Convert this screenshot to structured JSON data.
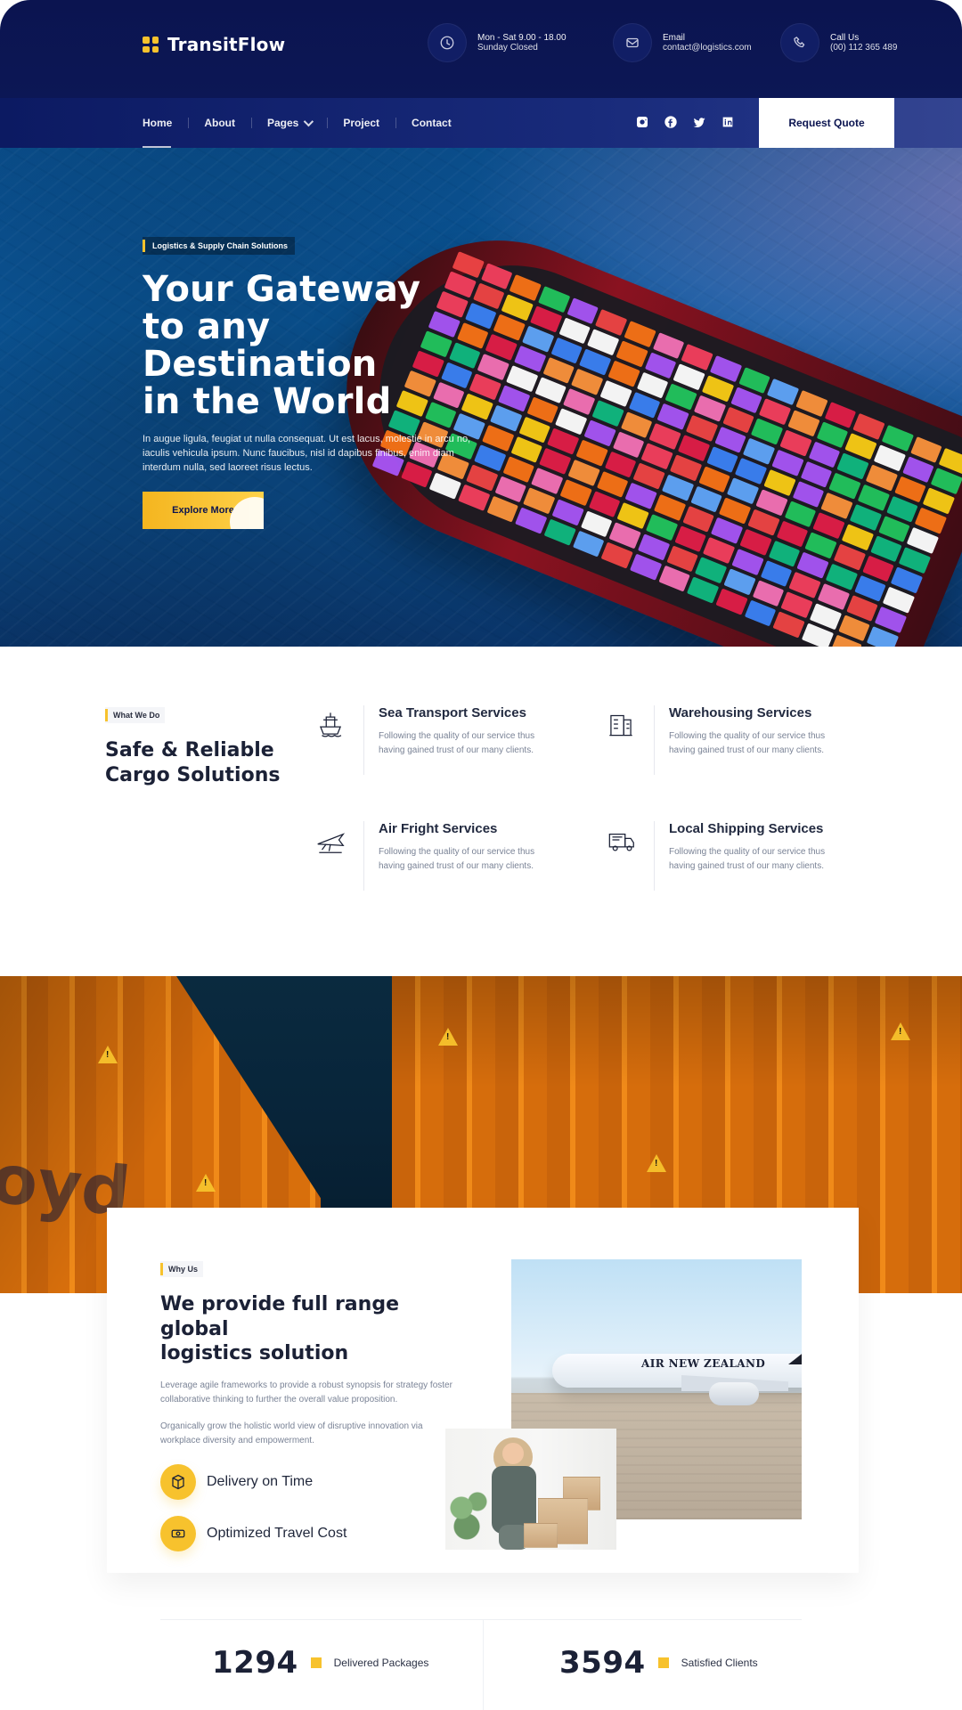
{
  "brand": {
    "name": "TransitFlow"
  },
  "topbar": {
    "contacts": [
      {
        "icon": "clock-icon",
        "line1": "Mon - Sat 9.00 - 18.00",
        "line2": "Sunday Closed"
      },
      {
        "icon": "mail-icon",
        "line1": "Email",
        "line2": "contact@logistics.com"
      },
      {
        "icon": "phone-icon",
        "line1": "Call Us",
        "line2": "(00) 112 365 489"
      }
    ]
  },
  "nav": {
    "items": [
      "Home",
      "About",
      "Pages",
      "Project",
      "Contact"
    ],
    "request_quote": "Request Quote",
    "socials": [
      "instagram-icon",
      "facebook-icon",
      "twitter-icon",
      "linkedin-icon"
    ]
  },
  "hero": {
    "eyebrow": "Logistics & Supply Chain Solutions",
    "title_lines": [
      "Your Gateway",
      "to any Destination",
      "in the World"
    ],
    "subtitle": "In augue ligula, feugiat ut nulla consequat. Ut est lacus, molestie in arcu no, iaculis vehicula ipsum. Nunc faucibus, nisl id dapibus finibus, enim diam interdum nulla, sed laoreet risus lectus.",
    "cta": "Explore More"
  },
  "services": {
    "tag": "What We Do",
    "title_lines": [
      "Safe & Reliable",
      "Cargo Solutions"
    ],
    "items": [
      {
        "icon": "ship-icon",
        "title": "Sea Transport Services",
        "desc": "Following the quality of our service thus having gained trust of our many clients."
      },
      {
        "icon": "warehouse-icon",
        "title": "Warehousing Services",
        "desc": "Following the quality of our service thus having gained trust of our many clients."
      },
      {
        "icon": "plane-icon",
        "title": "Air Fright Services",
        "desc": "Following the quality of our service thus having gained trust of our many clients."
      },
      {
        "icon": "truck-icon",
        "title": "Local Shipping Services",
        "desc": "Following the quality of our service thus having gained trust of our many clients."
      }
    ]
  },
  "photo_band": {
    "ghost_text": "oyd"
  },
  "why_us": {
    "tag": "Why Us",
    "title_lines": [
      "We provide full range global",
      "logistics solution"
    ],
    "paragraphs": [
      "Leverage agile frameworks to provide a robust synopsis for strategy foster collaborative thinking to further the overall value proposition.",
      "Organically grow the holistic world view of disruptive innovation via workplace diversity and empowerment."
    ],
    "features": [
      {
        "icon": "box-icon",
        "label": "Delivery on Time"
      },
      {
        "icon": "cash-icon",
        "label": "Optimized Travel Cost"
      }
    ],
    "images": {
      "plane_caption": "AIR NEW ZEALAND"
    }
  },
  "stats": [
    {
      "number": "1294",
      "label": "Delivered Packages"
    },
    {
      "number": "3594",
      "label": "Satisfied Clients"
    }
  ],
  "colors": {
    "navy": "#0b1450",
    "accent": "#f7c22d"
  }
}
